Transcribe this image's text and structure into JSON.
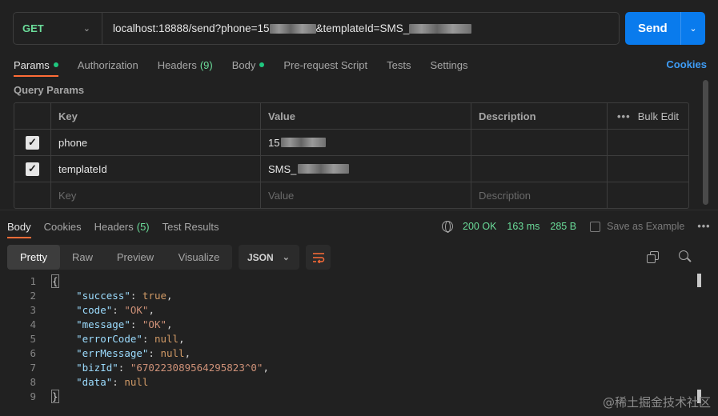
{
  "request": {
    "method": "GET",
    "url_prefix": "localhost:18888/send?phone=15",
    "url_middle": "&templateId=SMS_",
    "send_label": "Send"
  },
  "req_tabs": [
    {
      "label": "Params",
      "dot": true,
      "active": true
    },
    {
      "label": "Authorization"
    },
    {
      "label": "Headers",
      "count": "(9)"
    },
    {
      "label": "Body",
      "dot": true
    },
    {
      "label": "Pre-request Script"
    },
    {
      "label": "Tests"
    },
    {
      "label": "Settings"
    }
  ],
  "cookies_label": "Cookies",
  "query_params_title": "Query Params",
  "params_table": {
    "headers": {
      "key": "Key",
      "value": "Value",
      "description": "Description",
      "bulk_edit": "Bulk Edit"
    },
    "rows": [
      {
        "key": "phone",
        "value_prefix": "15",
        "checked": true
      },
      {
        "key": "templateId",
        "value_prefix": "SMS_",
        "checked": true
      }
    ],
    "placeholder": {
      "key": "Key",
      "value": "Value",
      "description": "Description"
    }
  },
  "res_tabs": [
    {
      "label": "Body",
      "active": true
    },
    {
      "label": "Cookies"
    },
    {
      "label": "Headers",
      "count": "(5)"
    },
    {
      "label": "Test Results"
    }
  ],
  "response_meta": {
    "status": "200 OK",
    "time": "163 ms",
    "size": "285 B",
    "save_label": "Save as Example"
  },
  "format_tabs": [
    {
      "label": "Pretty",
      "active": true
    },
    {
      "label": "Raw"
    },
    {
      "label": "Preview"
    },
    {
      "label": "Visualize"
    }
  ],
  "format_select": "JSON",
  "code_lines": [
    {
      "n": "1"
    },
    {
      "n": "2"
    },
    {
      "n": "3"
    },
    {
      "n": "4"
    },
    {
      "n": "5"
    },
    {
      "n": "6"
    },
    {
      "n": "7"
    },
    {
      "n": "8"
    },
    {
      "n": "9"
    }
  ],
  "json_body": {
    "open": "{",
    "close": "}",
    "entries": [
      {
        "key": "\"success\"",
        "value": "true",
        "type": "b",
        "comma": ","
      },
      {
        "key": "\"code\"",
        "value": "\"OK\"",
        "type": "s",
        "comma": ","
      },
      {
        "key": "\"message\"",
        "value": "\"OK\"",
        "type": "s",
        "comma": ","
      },
      {
        "key": "\"errorCode\"",
        "value": "null",
        "type": "b",
        "comma": ","
      },
      {
        "key": "\"errMessage\"",
        "value": "null",
        "type": "b",
        "comma": ","
      },
      {
        "key": "\"bizId\"",
        "value": "\"670223089564295823^0\"",
        "type": "s",
        "comma": ","
      },
      {
        "key": "\"data\"",
        "value": "null",
        "type": "b",
        "comma": ""
      }
    ]
  },
  "watermark": "@稀土掘金技术社区"
}
